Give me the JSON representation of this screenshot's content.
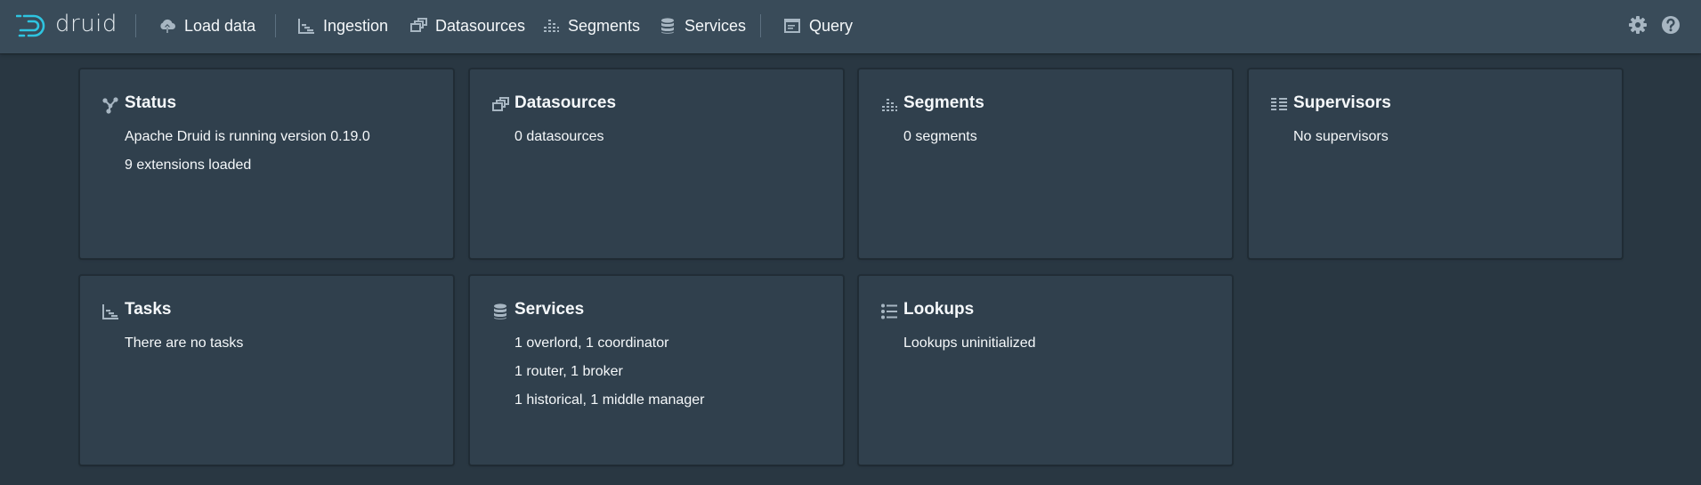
{
  "app": {
    "logo_text": "druid"
  },
  "nav": {
    "load_data": "Load data",
    "ingestion": "Ingestion",
    "datasources": "Datasources",
    "segments": "Segments",
    "services": "Services",
    "query": "Query"
  },
  "cards": {
    "status": {
      "title": "Status",
      "lines": [
        "Apache Druid is running version 0.19.0",
        "9 extensions loaded"
      ]
    },
    "datasources": {
      "title": "Datasources",
      "lines": [
        "0 datasources"
      ]
    },
    "segments": {
      "title": "Segments",
      "lines": [
        "0 segments"
      ]
    },
    "supervisors": {
      "title": "Supervisors",
      "lines": [
        "No supervisors"
      ]
    },
    "tasks": {
      "title": "Tasks",
      "lines": [
        "There are no tasks"
      ]
    },
    "services": {
      "title": "Services",
      "lines": [
        "1 overlord, 1 coordinator",
        "1 router, 1 broker",
        "1 historical, 1 middle manager"
      ]
    },
    "lookups": {
      "title": "Lookups",
      "lines": [
        "Lookups uninitialized"
      ]
    }
  },
  "colors": {
    "navbar": "#394b59",
    "background": "#293742",
    "card": "#30404d",
    "logo_accent": "#2ec4e0",
    "text": "#f5f8fa",
    "icon": "#a7b6c2"
  }
}
